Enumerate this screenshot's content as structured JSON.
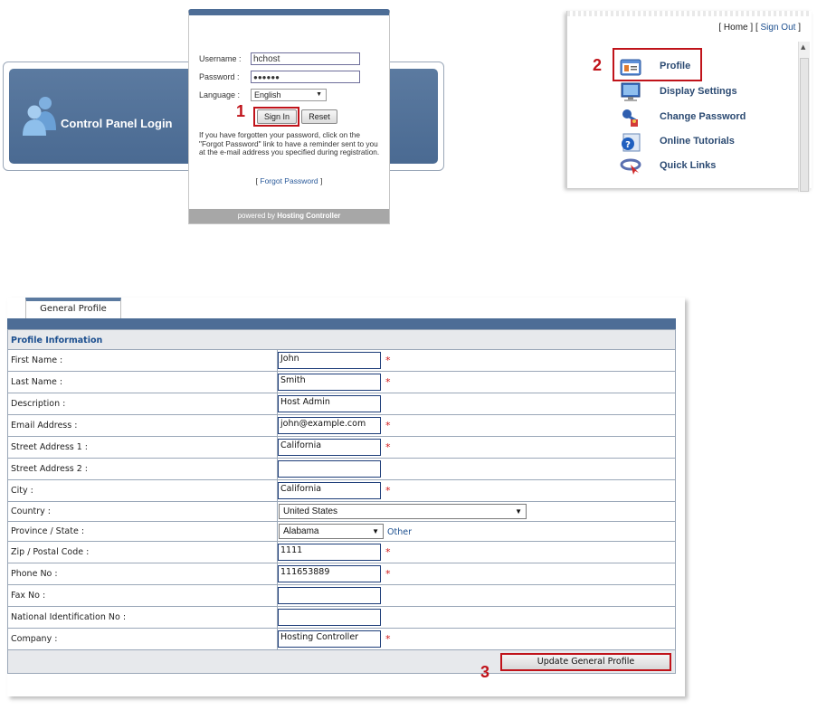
{
  "login": {
    "banner_title": "Control Panel Login",
    "username_label": "Username :",
    "username_value": "hchost",
    "password_label": "Password :",
    "password_value": "●●●●●●",
    "language_label": "Language :",
    "language_value": "English",
    "sign_in_label": "Sign In",
    "reset_label": "Reset",
    "forgot_note": "If you have forgotten your password, click on the \"Forgot Password\" link to have a reminder sent to you at the e-mail address you specified during registration.",
    "forgot_bracket_open": "[",
    "forgot_link": "Forgot Password",
    "forgot_bracket_close": "]",
    "powered_prefix": "powered by",
    "powered_brand": "Hosting Controller"
  },
  "steps": {
    "one": "1",
    "two": "2",
    "three": "3"
  },
  "menu": {
    "top_open": "[",
    "home_link": "Home",
    "top_mid": "] [",
    "sign_out_link": "Sign Out",
    "top_close": "]",
    "items": [
      {
        "label": "Profile",
        "icon": "profile-icon"
      },
      {
        "label": "Display Settings",
        "icon": "display-settings-icon"
      },
      {
        "label": "Change Password",
        "icon": "change-password-icon"
      },
      {
        "label": "Online Tutorials",
        "icon": "online-tutorials-icon"
      },
      {
        "label": "Quick Links",
        "icon": "quick-links-icon"
      }
    ]
  },
  "profile": {
    "tab_label": "General Profile",
    "section_title": "Profile Information",
    "fields": [
      {
        "label": "First Name :",
        "value": "John"
      },
      {
        "label": "Last Name :",
        "value": "Smith"
      },
      {
        "label": "Description :",
        "value": "Host Admin"
      },
      {
        "label": "Email Address :",
        "value": "john@example.com"
      },
      {
        "label": "Street Address 1 :",
        "value": "California"
      },
      {
        "label": "Street Address 2 :",
        "value": ""
      },
      {
        "label": "City :",
        "value": "California"
      },
      {
        "label": "Country :",
        "value": "United States"
      },
      {
        "label": "Province / State :",
        "value": "Alabama",
        "other_link": "Other"
      },
      {
        "label": "Zip / Postal Code :",
        "value": "1111"
      },
      {
        "label": "Phone No :",
        "value": "111653889"
      },
      {
        "label": "Fax No :",
        "value": ""
      },
      {
        "label": "National Identification No :",
        "value": ""
      },
      {
        "label": "Company :",
        "value": "Hosting Controller"
      }
    ],
    "required_mark": "*",
    "update_button": "Update General Profile"
  },
  "colors": {
    "brand_blue": "#4d6d96",
    "highlight_red": "#c0131a",
    "link_blue": "#1c4f8f"
  }
}
